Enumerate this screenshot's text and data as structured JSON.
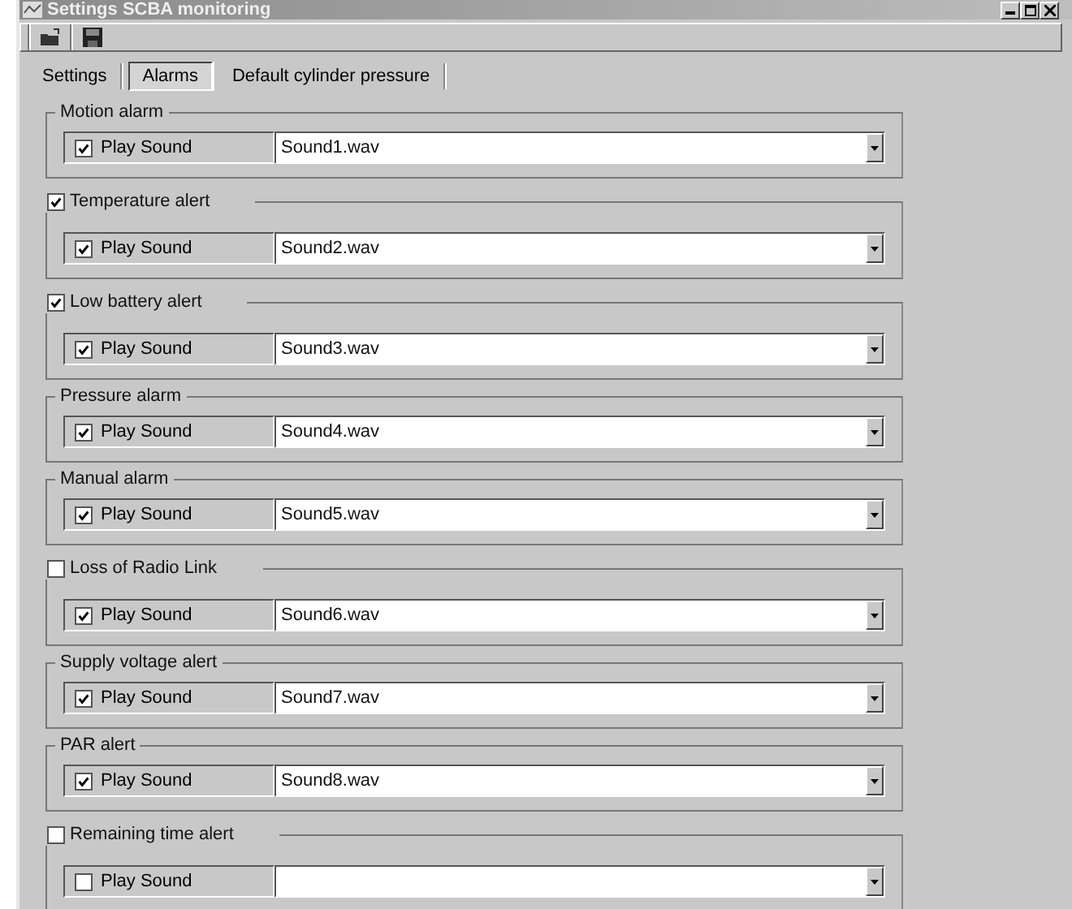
{
  "window": {
    "title": "Settings SCBA monitoring"
  },
  "tabs": [
    {
      "label": "Settings",
      "selected": false
    },
    {
      "label": "Alarms",
      "selected": true
    },
    {
      "label": "Default cylinder pressure",
      "selected": false
    }
  ],
  "groups": [
    {
      "kind": "plain",
      "title": "Motion alarm",
      "play_sound": {
        "label": "Play Sound",
        "checked": true
      },
      "sound": "Sound1.wav"
    },
    {
      "kind": "checkable",
      "title": "Temperature alert",
      "checked": true,
      "play_sound": {
        "label": "Play Sound",
        "checked": true
      },
      "sound": "Sound2.wav"
    },
    {
      "kind": "checkable",
      "title": "Low battery alert",
      "checked": true,
      "play_sound": {
        "label": "Play Sound",
        "checked": true
      },
      "sound": "Sound3.wav"
    },
    {
      "kind": "plain",
      "title": "Pressure alarm",
      "play_sound": {
        "label": "Play Sound",
        "checked": true
      },
      "sound": "Sound4.wav"
    },
    {
      "kind": "plain",
      "title": "Manual alarm",
      "play_sound": {
        "label": "Play Sound",
        "checked": true
      },
      "sound": "Sound5.wav"
    },
    {
      "kind": "checkable",
      "title": "Loss of Radio Link",
      "checked": false,
      "play_sound": {
        "label": "Play Sound",
        "checked": true
      },
      "sound": "Sound6.wav"
    },
    {
      "kind": "plain",
      "title": "Supply voltage alert",
      "play_sound": {
        "label": "Play Sound",
        "checked": true
      },
      "sound": "Sound7.wav"
    },
    {
      "kind": "plain",
      "title": "PAR alert",
      "play_sound": {
        "label": "Play Sound",
        "checked": true
      },
      "sound": "Sound8.wav"
    },
    {
      "kind": "checkable",
      "title": "Remaining time alert",
      "checked": false,
      "play_sound": {
        "label": "Play Sound",
        "checked": false
      }
    }
  ]
}
